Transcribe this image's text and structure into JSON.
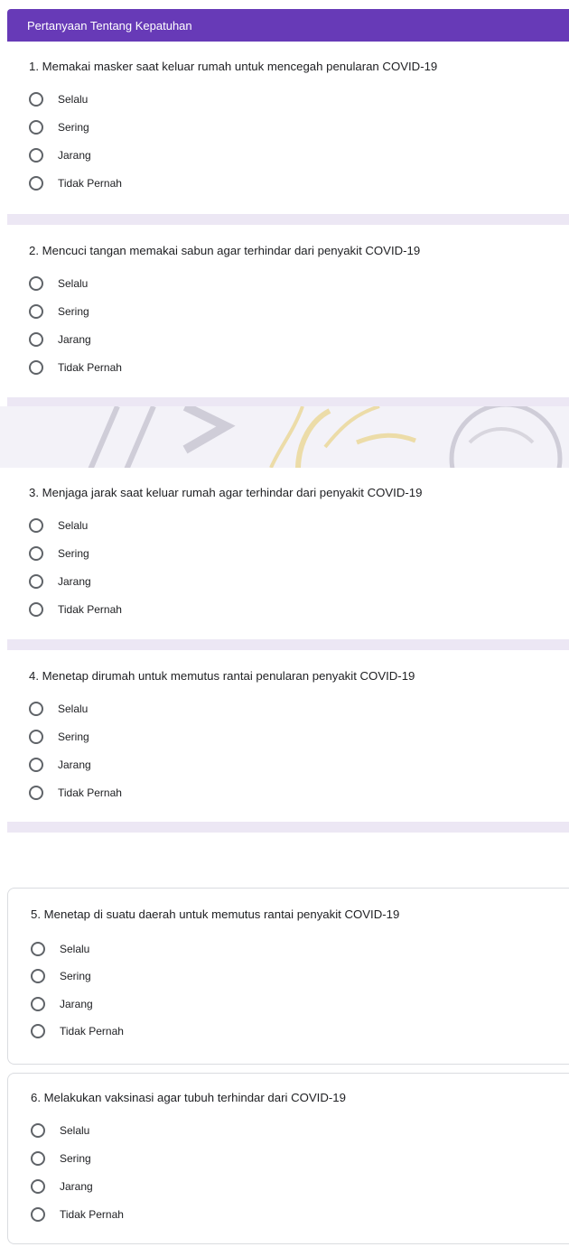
{
  "section": {
    "title": "Pertanyaan Tentang Kepatuhan"
  },
  "options": [
    "Selalu",
    "Sering",
    "Jarang",
    "Tidak Pernah"
  ],
  "questions": [
    {
      "text": "1. Memakai masker saat keluar rumah untuk mencegah penularan COVID-19"
    },
    {
      "text": "2. Mencuci tangan memakai sabun agar terhindar dari penyakit COVID-19"
    },
    {
      "text": "3. Menjaga jarak saat keluar rumah agar terhindar dari penyakit COVID-19"
    },
    {
      "text": "4. Menetap dirumah untuk memutus rantai penularan penyakit COVID-19"
    },
    {
      "text": "5. Menetap di suatu daerah untuk memutus rantai penyakit COVID-19"
    },
    {
      "text": "6. Melakukan vaksinasi agar tubuh terhindar dari COVID-19"
    }
  ],
  "colors": {
    "accent": "#673ab7",
    "band": "#ece7f4",
    "radio": "#5f6368"
  }
}
